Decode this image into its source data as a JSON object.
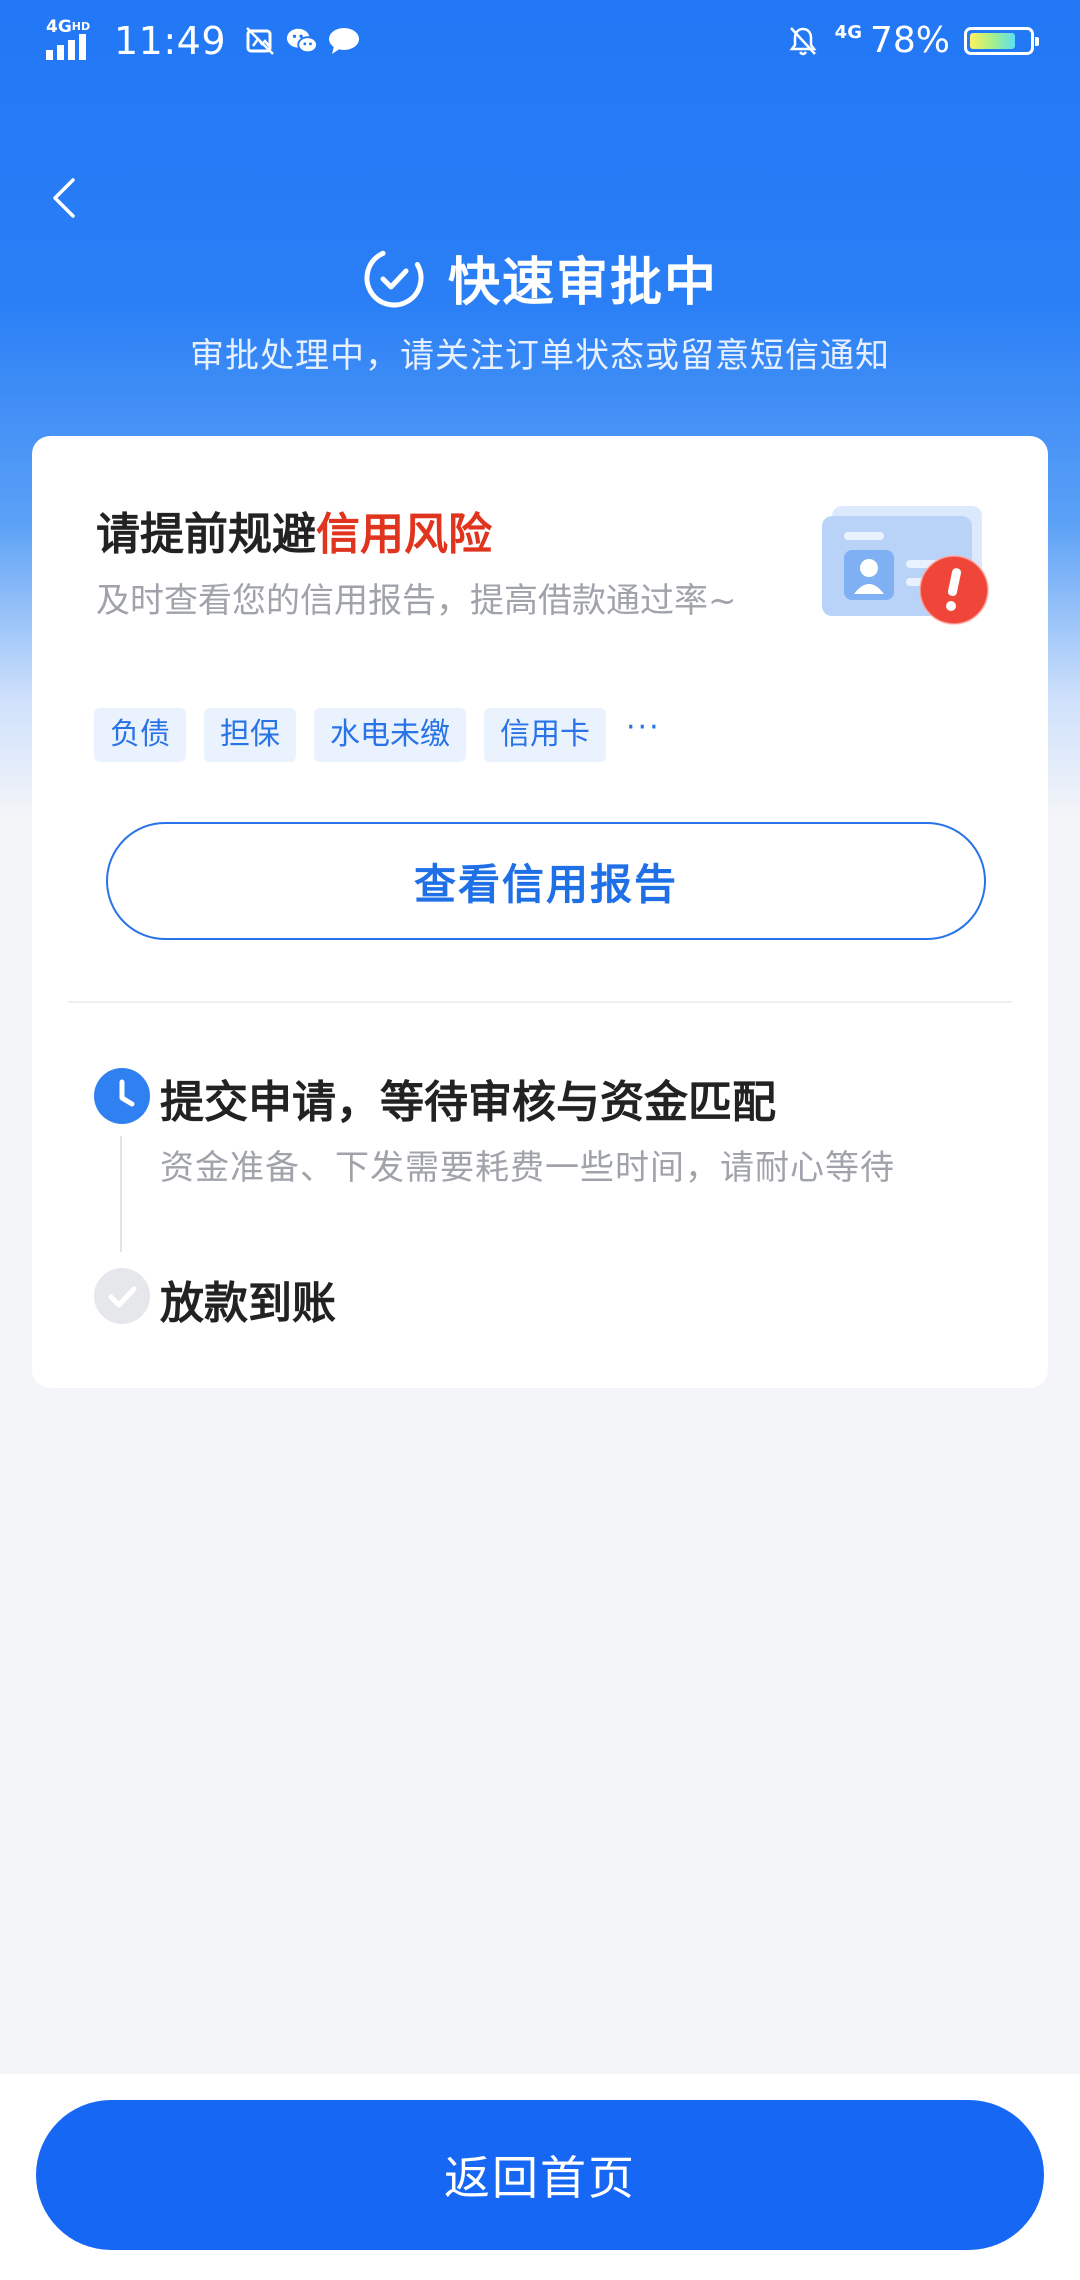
{
  "status_bar": {
    "network": "4G",
    "network_hd": "HD",
    "time": "11:49",
    "network_right": "4G",
    "battery_percent": "78%",
    "battery_level": 0.78
  },
  "header": {
    "title": "快速审批中",
    "subtitle": "审批处理中，请关注订单状态或留意短信通知"
  },
  "risk_card": {
    "title_prefix": "请提前规避",
    "title_highlight": "信用风险",
    "description": "及时查看您的信用报告，提高借款通过率~",
    "tags": [
      "负债",
      "担保",
      "水电未缴",
      "信用卡"
    ],
    "tags_more": "···",
    "button_label": "查看信用报告"
  },
  "steps": [
    {
      "title": "提交申请，等待审核与资金匹配",
      "description": "资金准备、下发需要耗费一些时间，请耐心等待",
      "status": "in-progress"
    },
    {
      "title": "放款到账",
      "status": "pending"
    }
  ],
  "footer": {
    "home_button_label": "返回首页"
  },
  "colors": {
    "primary": "#1767f5",
    "highlight": "#e0341f",
    "tag_bg": "#eaf2fe"
  }
}
